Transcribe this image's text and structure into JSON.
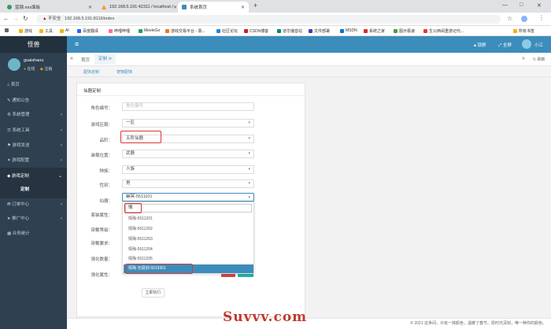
{
  "browser": {
    "tabs": [
      {
        "title": "蓝钢.mix面板",
        "color": "#2e9d5b",
        "active": false
      },
      {
        "title": "192.168.5.191:42311 / localhost /",
        "color": "#f0a020",
        "active": false
      },
      {
        "title": "系统首页",
        "color": "#3c8dbc",
        "active": true
      }
    ],
    "new_tab": "+",
    "insecure_label": "不安全",
    "url": "192.168.5.191:8116/index",
    "bookmarks": [
      "游戏",
      "工具",
      "AI",
      "百度翻译",
      "哔哩哔哩",
      "MeeleGo",
      "游戏交易平台 - 靠...",
      "社区论坛",
      "CSDN博客",
      "道华播音站",
      "文件部署",
      "MSDN",
      "系统之家",
      "图示极速",
      "生公西闹重游记代..."
    ],
    "bookmarks_more": "所有书签"
  },
  "sidebar": {
    "logo": "怪兽",
    "username": "guaishaou",
    "status_online": "在线",
    "status_logout": "注销",
    "items": [
      {
        "label": "首页",
        "has_arrow": false
      },
      {
        "label": "通知公告",
        "has_arrow": false
      },
      {
        "label": "系统管理",
        "has_arrow": true
      },
      {
        "label": "系统工具",
        "has_arrow": true
      },
      {
        "label": "游戏发送",
        "has_arrow": true
      },
      {
        "label": "游戏配置",
        "has_arrow": true
      },
      {
        "label": "游戏定制",
        "has_arrow": true
      }
    ],
    "sub_active": "定制",
    "items_after": [
      {
        "label": "订单中心",
        "has_arrow": true
      },
      {
        "label": "推广中心",
        "has_arrow": true
      },
      {
        "label": "业务统计",
        "has_arrow": false
      }
    ]
  },
  "topbar": {
    "lock": "锁屏",
    "fullscreen": "全屏",
    "user": "小江"
  },
  "tabs": {
    "home": "首页",
    "current": "定制",
    "refresh": "刷新"
  },
  "subtabs": [
    "配饰定制",
    "宠物配饰"
  ],
  "form": {
    "title": "仙器定制",
    "fields": [
      {
        "label": "角色编号：",
        "value": "角色编号",
        "placeholder": true
      },
      {
        "label": "游戏区服：",
        "value": "一区"
      },
      {
        "label": "品阶：",
        "value": "五阶仙器"
      },
      {
        "label": "装载位置：",
        "value": "武器"
      },
      {
        "label": "种族：",
        "value": "人族"
      },
      {
        "label": "性别：",
        "value": "男"
      },
      {
        "label": "仙器：",
        "value": "幽冥-5511101"
      }
    ],
    "labels_hidden": [
      "套装属性：",
      "穿戴等级：",
      "穿戴要求：",
      "强化数量：",
      "强化属性："
    ],
    "submit": "立即执行"
  },
  "dropdown": {
    "search_value": "情",
    "options": [
      "情殇-5511201",
      "情殇-5511202",
      "情殇-5511203",
      "情殇-5511204",
      "情殇-5511205",
      "情殇·无极剑-5519301"
    ],
    "selected_index": 5
  },
  "footer": "© 2021 这世间，众有一抹颜色，温暖了春节。愿时光深刻，唯一种你的颜色。",
  "watermark": "Suvvv.com",
  "colors": {
    "accent": "#3c8dbc",
    "sidebar": "#2f4050",
    "highlight": "#d93636"
  }
}
